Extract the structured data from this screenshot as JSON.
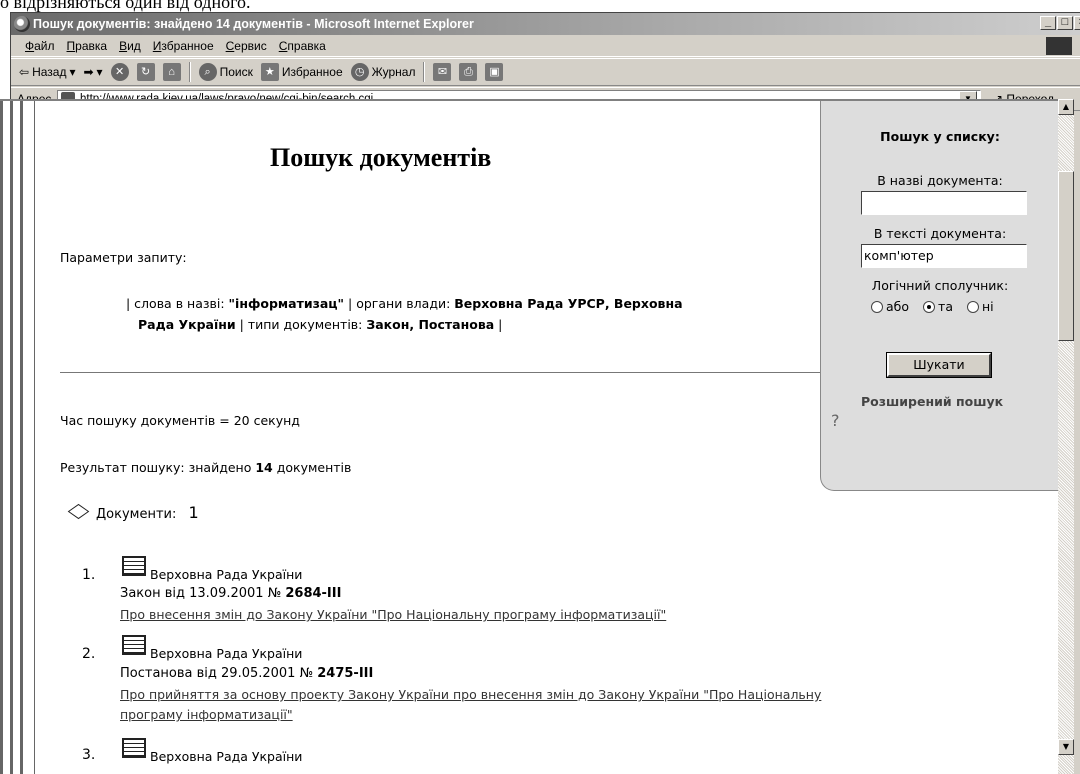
{
  "caption": "о відрізняються один від одного.",
  "window": {
    "title": "Пошук документів: знайдено 14 документів - Microsoft Internet Explorer",
    "buttons": [
      "_",
      "□",
      "×"
    ]
  },
  "menu": [
    "Файл",
    "Правка",
    "Вид",
    "Избранное",
    "Сервис",
    "Справка"
  ],
  "toolbar": {
    "back": "Назад",
    "search": "Поиск",
    "favorites": "Избранное",
    "history": "Журнал"
  },
  "address": {
    "label": "Адрес",
    "url": "http://www.rada.kiev.ua/laws/pravo/new/cgi-bin/search.cgi",
    "go": "Переход"
  },
  "page": {
    "title": "Пошук документів",
    "params_label": "Параметри запиту:",
    "params_1": "| слова в назві: ",
    "params_1b": "\"інформатизац\"",
    "params_2": " | органи влади: ",
    "params_2b": "Верховна Рада УРСР, Верховна",
    "params_3b": "Рада України",
    "params_4": " | типи документів: ",
    "params_4b": "Закон, Постанова",
    "params_5": " |",
    "time": "Час пошуку документів = 20 секунд",
    "result_prefix": "Результат пошуку: знайдено ",
    "result_count": "14",
    "result_suffix": " документів",
    "docs_label": "Документи:",
    "docs_page": "1"
  },
  "results": [
    {
      "num": "1.",
      "org": "Верховна Рада України",
      "meta": "Закон  від 13.09.2001  № ",
      "number": "2684-III",
      "title_1": "Про внесення змін до Закону України \"Про Національну програму інформатизації\"",
      "title_2": ""
    },
    {
      "num": "2.",
      "org": "Верховна Рада України",
      "meta": "Постанова  від 29.05.2001  № ",
      "number": "2475-III",
      "title_1": "Про прийняття за основу проекту Закону України про внесення змін до Закону України \"Про Національну",
      "title_2": "програму інформатизації\""
    },
    {
      "num": "3.",
      "org": "Верховна Рада України"
    }
  ],
  "search_panel": {
    "title": "Пошук у списку:",
    "name_label": "В назві документа:",
    "name_value": "",
    "text_label": "В тексті документа:",
    "text_value": "комп'ютер",
    "logic_label": "Логічний сполучник:",
    "options": [
      "або",
      "та",
      "ні"
    ],
    "selected": "та",
    "button": "Шукати",
    "advanced": "Розширений пошук",
    "help": "?"
  }
}
